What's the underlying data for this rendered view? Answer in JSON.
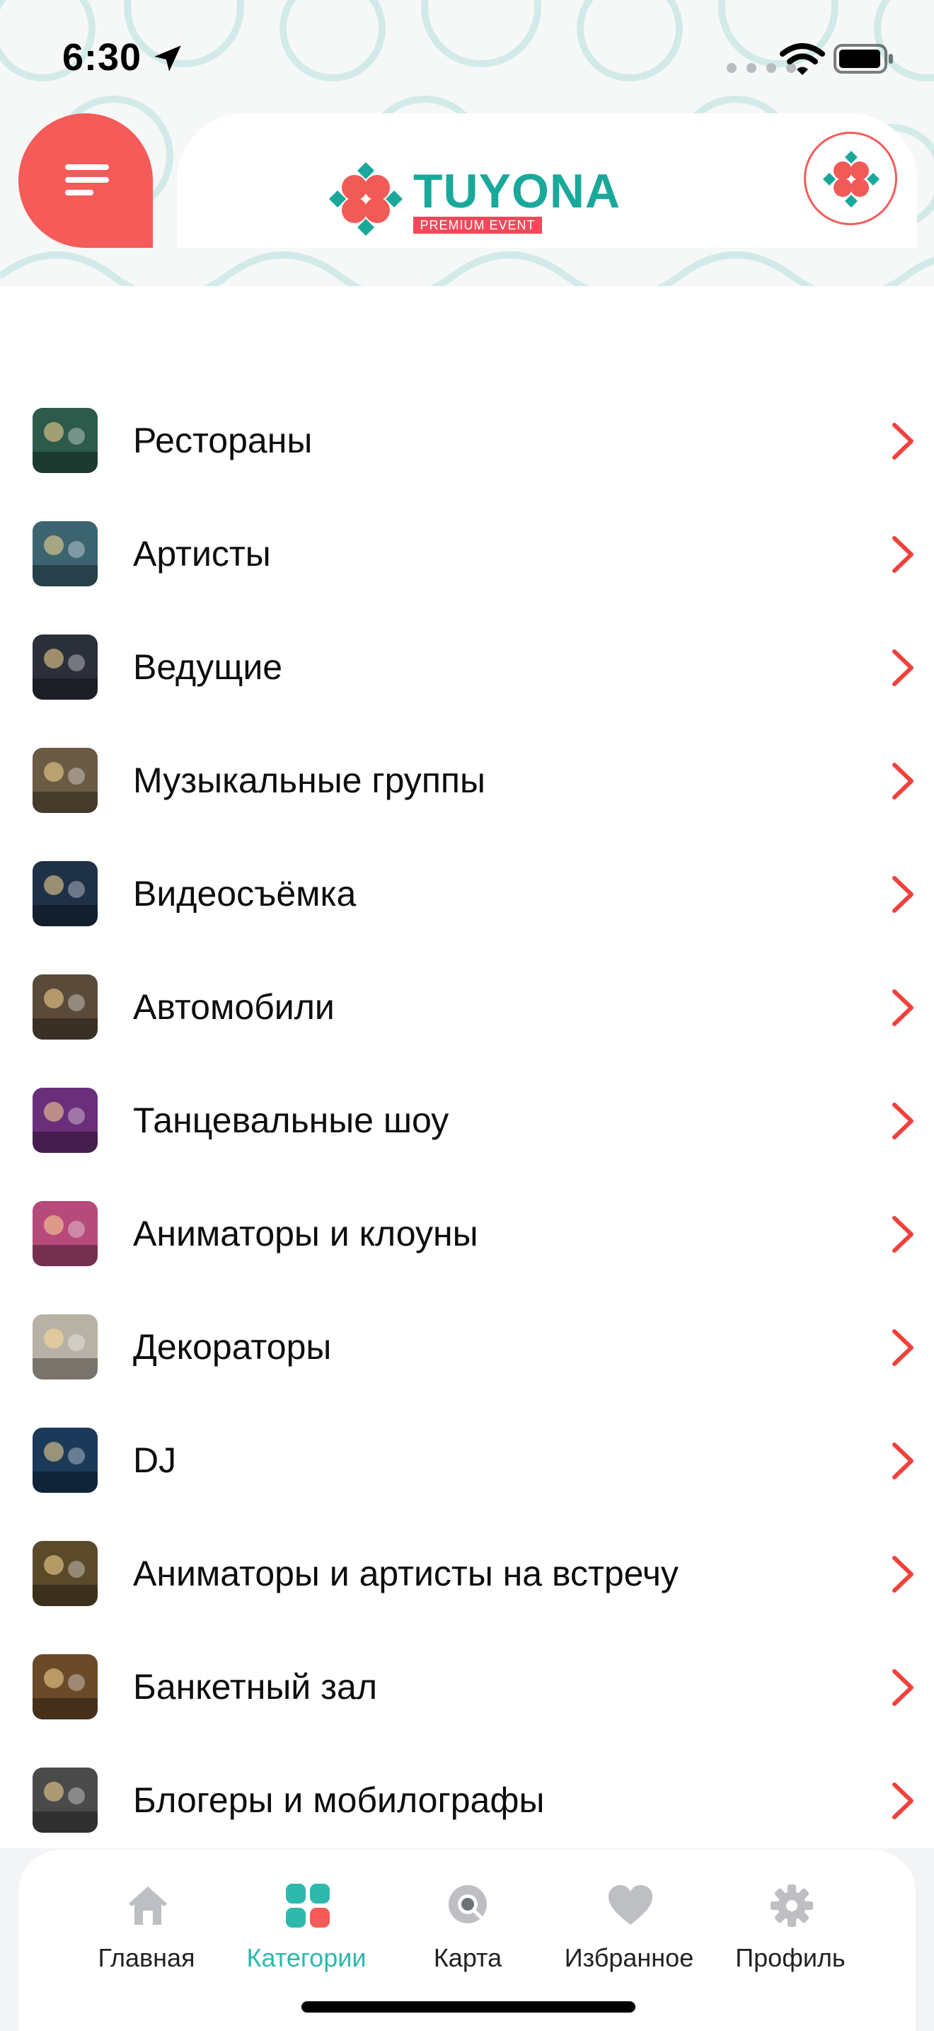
{
  "status_bar": {
    "time": "6:30"
  },
  "header": {
    "logo_text": "TUYONA",
    "logo_subtitle": "PREMIUM EVENT",
    "menu_icon": "hamburger-icon",
    "brand_icon": "flower-icon"
  },
  "categories": [
    {
      "label": "Рестораны",
      "thumb_color": "#2d5a4a"
    },
    {
      "label": "Артисты",
      "thumb_color": "#3b6470"
    },
    {
      "label": "Ведущие",
      "thumb_color": "#2a2f3a"
    },
    {
      "label": "Музыкальные группы",
      "thumb_color": "#6b5a44"
    },
    {
      "label": "Видеосъёмка",
      "thumb_color": "#1f3147"
    },
    {
      "label": "Автомобили",
      "thumb_color": "#5a4a3a"
    },
    {
      "label": "Танцевальные шоу",
      "thumb_color": "#6a2f7a"
    },
    {
      "label": "Аниматоры и клоуны",
      "thumb_color": "#b64a7a"
    },
    {
      "label": "Декораторы",
      "thumb_color": "#b8b2a6"
    },
    {
      "label": "DJ",
      "thumb_color": "#1b3a5a"
    },
    {
      "label": "Аниматоры и артисты на встречу",
      "thumb_color": "#5a4a2a"
    },
    {
      "label": "Банкетный зал",
      "thumb_color": "#6b4a2a"
    },
    {
      "label": "Блогеры и мобилографы",
      "thumb_color": "#4a4a4a"
    }
  ],
  "tab_bar": {
    "tabs": [
      {
        "label": "Главная",
        "icon": "home-icon"
      },
      {
        "label": "Категории",
        "icon": "grid-icon",
        "active": true
      },
      {
        "label": "Карта",
        "icon": "map-search-icon"
      },
      {
        "label": "Избранное",
        "icon": "heart-icon"
      },
      {
        "label": "Профиль",
        "icon": "gear-icon"
      }
    ]
  },
  "colors": {
    "accent_red": "#f45b59",
    "accent_teal": "#2fb8ad",
    "chevron": "#f1413d"
  }
}
